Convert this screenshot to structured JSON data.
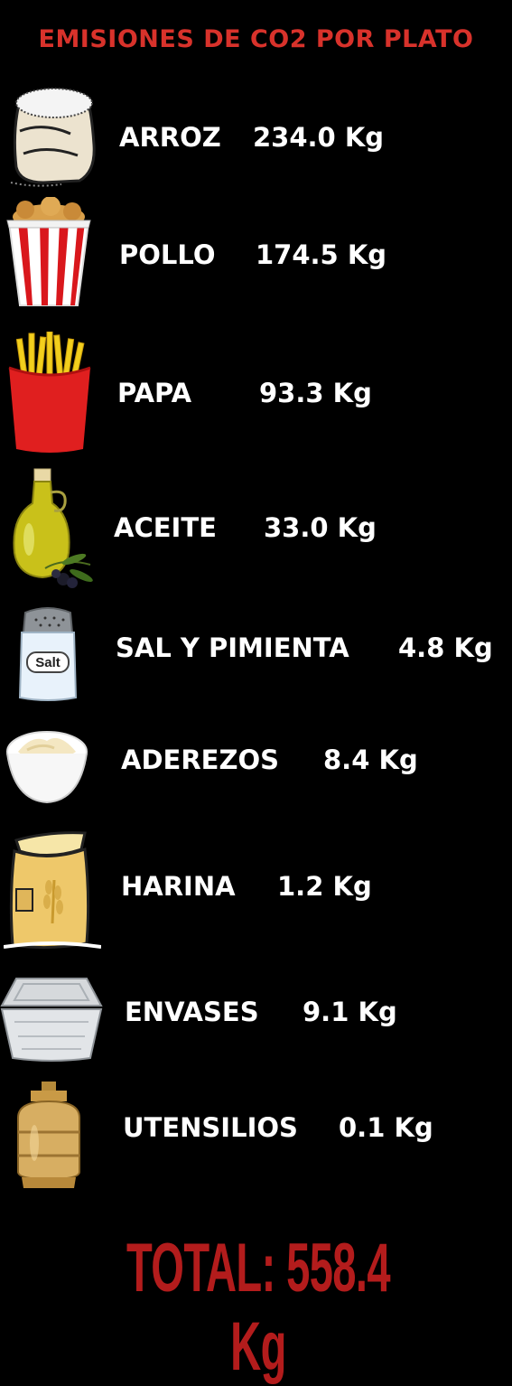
{
  "title": "EMISIONES DE CO2 POR PLATO",
  "colors": {
    "title": "#d8322b",
    "text": "#ffffff",
    "total": "#b31c1c",
    "background": "#000000"
  },
  "items": [
    {
      "name": "ARROZ",
      "value": "234.0 Kg",
      "icon": "rice-sack-icon"
    },
    {
      "name": "POLLO",
      "value": "174.5 Kg",
      "icon": "fried-chicken-bucket-icon"
    },
    {
      "name": "PAPA",
      "value": "93.3 Kg",
      "icon": "french-fries-icon"
    },
    {
      "name": "ACEITE",
      "value": "33.0 Kg",
      "icon": "olive-oil-bottle-icon"
    },
    {
      "name": "SAL Y PIMIENTA",
      "value": "4.8 Kg",
      "icon": "salt-shaker-icon",
      "icon_text": "Salt"
    },
    {
      "name": "ADEREZOS",
      "value": "8.4 Kg",
      "icon": "mayonnaise-bowl-icon"
    },
    {
      "name": "HARINA",
      "value": "1.2 Kg",
      "icon": "flour-sack-icon"
    },
    {
      "name": "ENVASES",
      "value": "9.1 Kg",
      "icon": "plastic-container-icon"
    },
    {
      "name": "UTENSILIOS",
      "value": "0.1 Kg",
      "icon": "gas-cylinder-icon"
    }
  ],
  "total": "TOTAL: 558.4 Kg"
}
